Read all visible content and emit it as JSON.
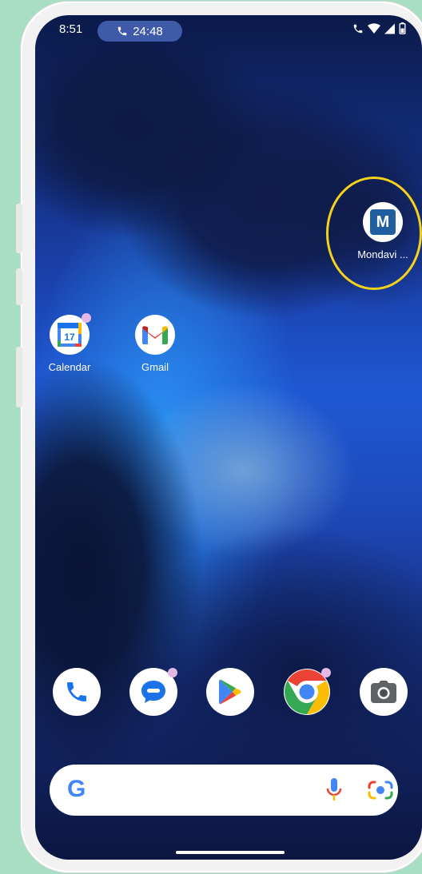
{
  "status_bar": {
    "time": "8:51",
    "call_duration": "24:48",
    "icons": [
      "call-icon",
      "signal-icon",
      "wifi-icon",
      "battery-icon"
    ]
  },
  "apps": {
    "mondavi": {
      "label": "Mondavi ...",
      "letter": "M"
    },
    "calendar": {
      "label": "Calendar",
      "day": "17"
    },
    "gmail": {
      "label": "Gmail"
    }
  },
  "dock": [
    {
      "name": "phone-icon"
    },
    {
      "name": "messages-icon"
    },
    {
      "name": "play-store-icon"
    },
    {
      "name": "chrome-icon"
    },
    {
      "name": "camera-icon"
    }
  ],
  "search_bar": {
    "logo": "G",
    "icons": [
      "mic-icon",
      "lens-icon"
    ]
  },
  "colors": {
    "highlight": "#f4d21a",
    "mondavi_brand": "#1f5fa0",
    "background": "#a8dfc4"
  }
}
